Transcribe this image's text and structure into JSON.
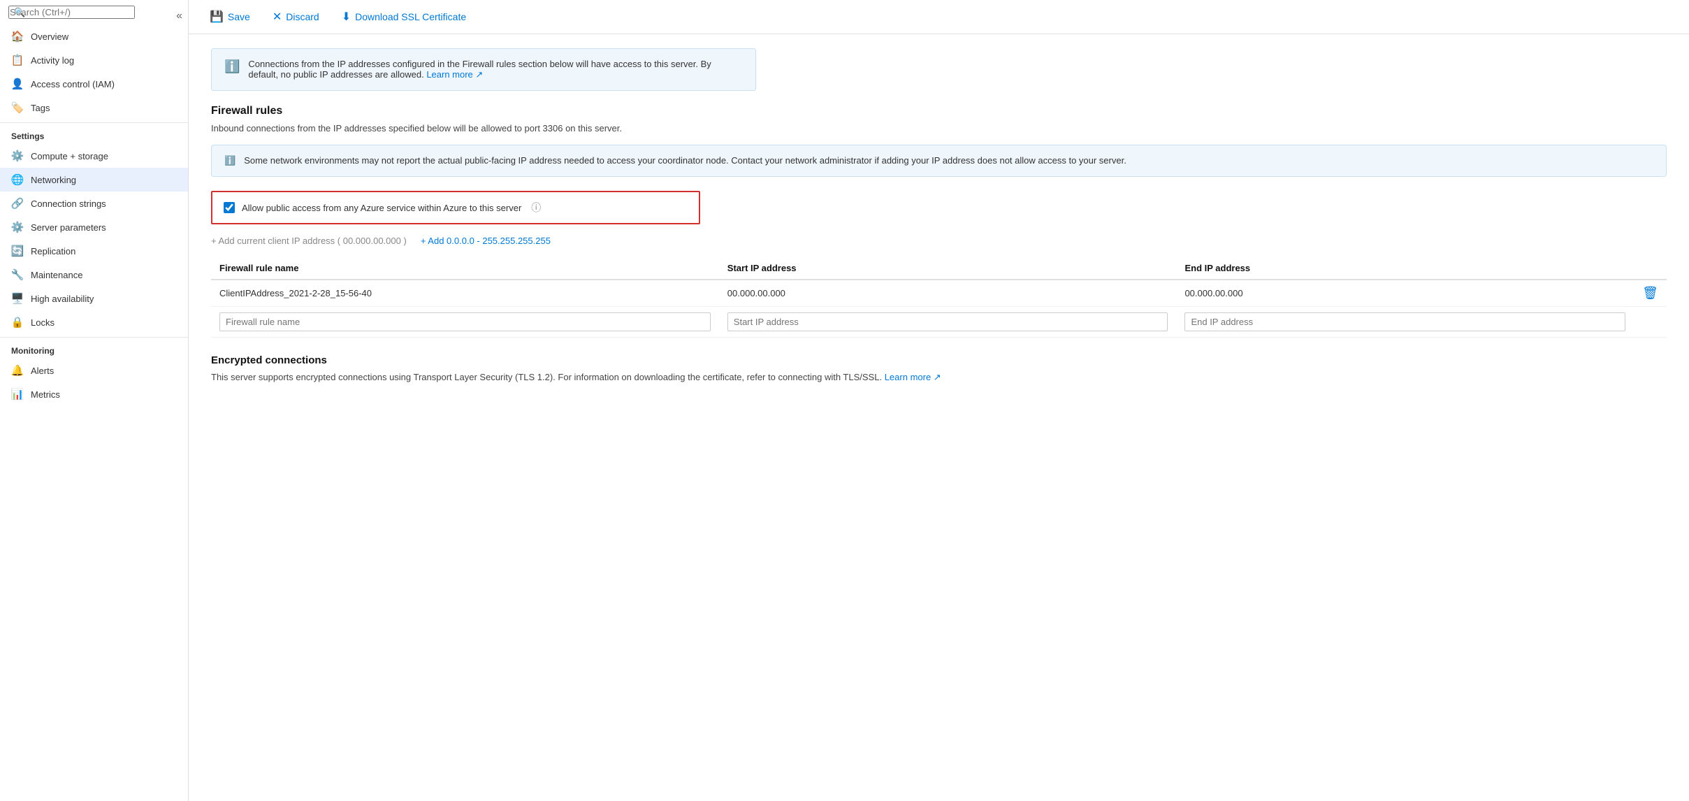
{
  "sidebar": {
    "search_placeholder": "Search (Ctrl+/)",
    "collapse_icon": "«",
    "items_top": [
      {
        "id": "overview",
        "label": "Overview",
        "icon": "🏠"
      },
      {
        "id": "activity-log",
        "label": "Activity log",
        "icon": "📋"
      },
      {
        "id": "access-control",
        "label": "Access control (IAM)",
        "icon": "👤"
      },
      {
        "id": "tags",
        "label": "Tags",
        "icon": "🏷️"
      }
    ],
    "section_settings": "Settings",
    "items_settings": [
      {
        "id": "compute-storage",
        "label": "Compute + storage",
        "icon": "⚙️"
      },
      {
        "id": "networking",
        "label": "Networking",
        "icon": "🌐",
        "active": true
      },
      {
        "id": "connection-strings",
        "label": "Connection strings",
        "icon": "🔗"
      },
      {
        "id": "server-parameters",
        "label": "Server parameters",
        "icon": "⚙️"
      },
      {
        "id": "replication",
        "label": "Replication",
        "icon": "🔄"
      },
      {
        "id": "maintenance",
        "label": "Maintenance",
        "icon": "🔧"
      },
      {
        "id": "high-availability",
        "label": "High availability",
        "icon": "🖥️"
      },
      {
        "id": "locks",
        "label": "Locks",
        "icon": "🔒"
      }
    ],
    "section_monitoring": "Monitoring",
    "items_monitoring": [
      {
        "id": "alerts",
        "label": "Alerts",
        "icon": "🔔"
      },
      {
        "id": "metrics",
        "label": "Metrics",
        "icon": "📊"
      }
    ]
  },
  "toolbar": {
    "save_label": "Save",
    "discard_label": "Discard",
    "download_ssl_label": "Download SSL Certificate"
  },
  "content": {
    "info_banner_text": "Connections from the IP addresses configured in the Firewall rules section below will have access to this server. By default, no public IP addresses are allowed.",
    "info_banner_learn_more": "Learn more",
    "firewall_rules_title": "Firewall rules",
    "firewall_rules_desc": "Inbound connections from the IP addresses specified below will be allowed to port 3306 on this server.",
    "network_warning": "Some network environments may not report the actual public-facing IP address needed to access your coordinator node. Contact your network administrator if adding your IP address does not allow access to your server.",
    "allow_azure_label": "Allow public access from any Azure service within Azure to this server",
    "allow_azure_checked": true,
    "add_client_ip": "+ Add current client IP address ( 00.000.00.000 )",
    "add_range_link": "+ Add 0.0.0.0 - 255.255.255.255",
    "table": {
      "col_rule_name": "Firewall rule name",
      "col_start_ip": "Start IP address",
      "col_end_ip": "End IP address",
      "rows": [
        {
          "rule_name": "ClientIPAddress_2021-2-28_15-56-40",
          "start_ip": "00.000.00.000",
          "end_ip": "00.000.00.000"
        }
      ],
      "new_row_placeholders": {
        "rule_name": "Firewall rule name",
        "start_ip": "Start IP address",
        "end_ip": "End IP address"
      }
    },
    "encrypted_title": "Encrypted connections",
    "encrypted_desc": "This server supports encrypted connections using Transport Layer Security (TLS 1.2). For information on downloading the certificate, refer to connecting with TLS/SSL.",
    "encrypted_learn_more": "Learn more"
  }
}
